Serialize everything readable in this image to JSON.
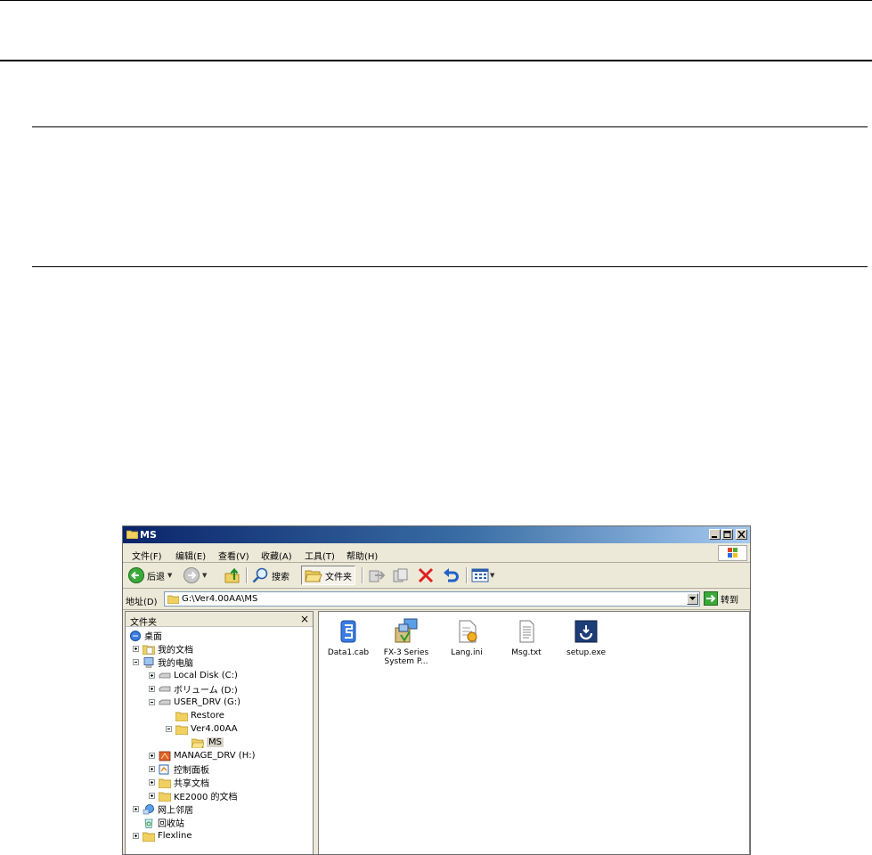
{
  "window": {
    "title": "MS",
    "menu": [
      "文件(F)",
      "编辑(E)",
      "查看(V)",
      "收藏(A)",
      "工具(T)",
      "帮助(H)"
    ],
    "toolbar": {
      "back_label": "后退",
      "search_label": "搜索",
      "folders_label": "文件夹"
    },
    "address": {
      "label": "地址(D)",
      "value": "G:\\Ver4.00AA\\MS",
      "go_label": "转到"
    },
    "folders_pane": {
      "header": "文件夹",
      "close": "×",
      "tree": [
        {
          "label": "桌面"
        },
        {
          "label": "我的文档"
        },
        {
          "label": "我的电脑"
        },
        {
          "label": "Local Disk (C:)"
        },
        {
          "label": "ボリューム (D:)"
        },
        {
          "label": "USER_DRV (G:)"
        },
        {
          "label": "Restore"
        },
        {
          "label": "Ver4.00AA"
        },
        {
          "label": "MS"
        },
        {
          "label": "MANAGE_DRV (H:)"
        },
        {
          "label": "控制面板"
        },
        {
          "label": "共享文档"
        },
        {
          "label": "KE2000 的文档"
        },
        {
          "label": "网上邻居"
        },
        {
          "label": "回收站"
        },
        {
          "label": "Flexline"
        }
      ]
    },
    "files": [
      {
        "name": "Data1.cab",
        "icon": "cab-icon"
      },
      {
        "name": "FX-3 Series System P...",
        "icon": "installer-package-icon"
      },
      {
        "name": "Lang.ini",
        "icon": "ini-file-icon"
      },
      {
        "name": "Msg.txt",
        "icon": "text-file-icon"
      },
      {
        "name": "setup.exe",
        "icon": "setup-exe-icon"
      }
    ]
  }
}
